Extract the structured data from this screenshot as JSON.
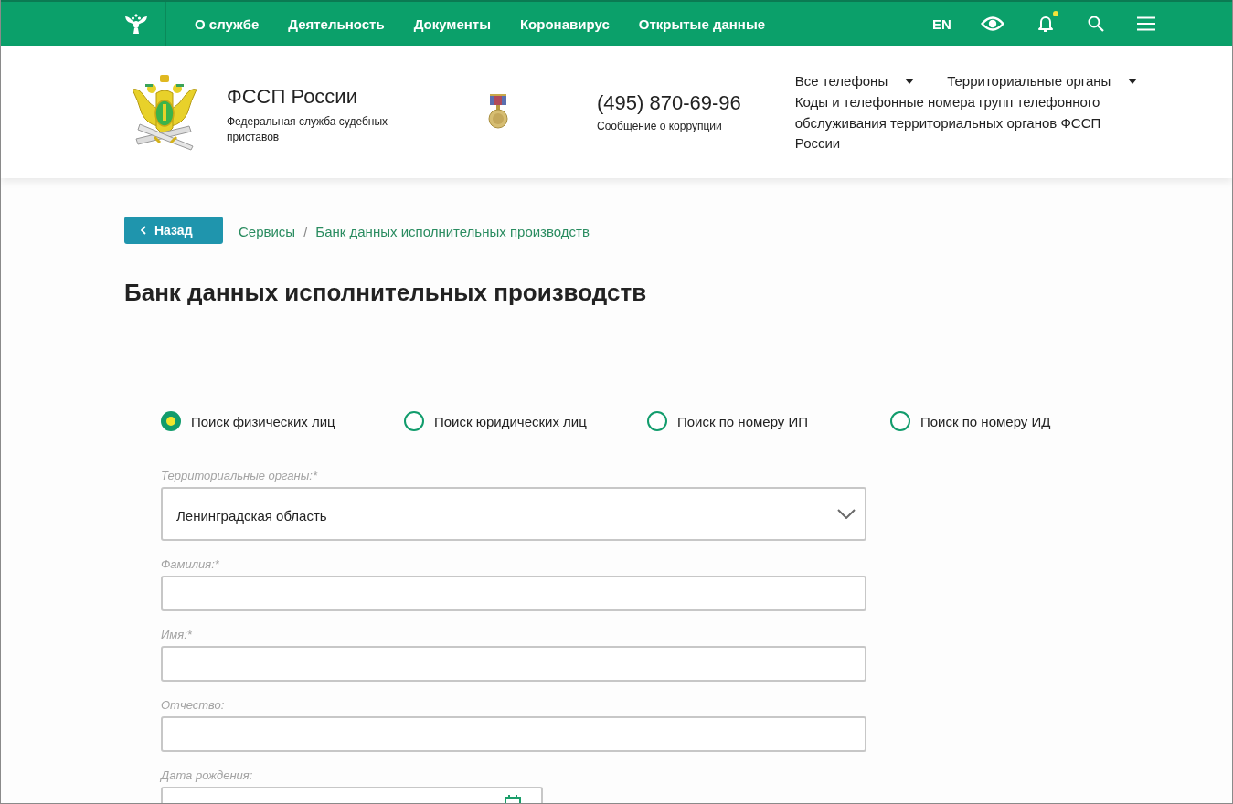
{
  "top_nav": {
    "items": [
      {
        "label": "О службе"
      },
      {
        "label": "Деятельность"
      },
      {
        "label": "Документы"
      },
      {
        "label": "Коронавирус"
      },
      {
        "label": "Открытые данные"
      }
    ],
    "language": "EN",
    "notifications_unread": true
  },
  "header": {
    "org_name": "ФССП России",
    "org_subtitle": "Федеральная служба судебных приставов",
    "phone": "(495) 870-69-96",
    "phone_caption": "Сообщение о коррупции",
    "dropdowns": [
      {
        "label": "Все телефоны"
      },
      {
        "label": "Территориальные органы"
      }
    ],
    "phone_codes_link": "Коды и телефонные номера групп телефонного обслуживания территориальных органов ФССП России"
  },
  "back_button": "Назад",
  "breadcrumb": {
    "items": [
      {
        "label": "Сервисы"
      },
      {
        "label": "Банк данных исполнительных производств"
      }
    ],
    "separator": "/"
  },
  "page_title": "Банк данных исполнительных производств",
  "search_types": [
    {
      "label": "Поиск физических лиц",
      "selected": true
    },
    {
      "label": "Поиск юридических лиц",
      "selected": false
    },
    {
      "label": "Поиск по номеру ИП",
      "selected": false
    },
    {
      "label": "Поиск по номеру ИД",
      "selected": false
    }
  ],
  "form": {
    "fields": [
      {
        "kind": "select",
        "label": "Территориальные органы:*",
        "value": "Ленинградская область"
      },
      {
        "kind": "text",
        "label": "Фамилия:*"
      },
      {
        "kind": "text",
        "label": "Имя:*"
      },
      {
        "kind": "text",
        "label": "Отчество:"
      },
      {
        "kind": "date",
        "label": "Дата рождения:"
      }
    ]
  }
}
